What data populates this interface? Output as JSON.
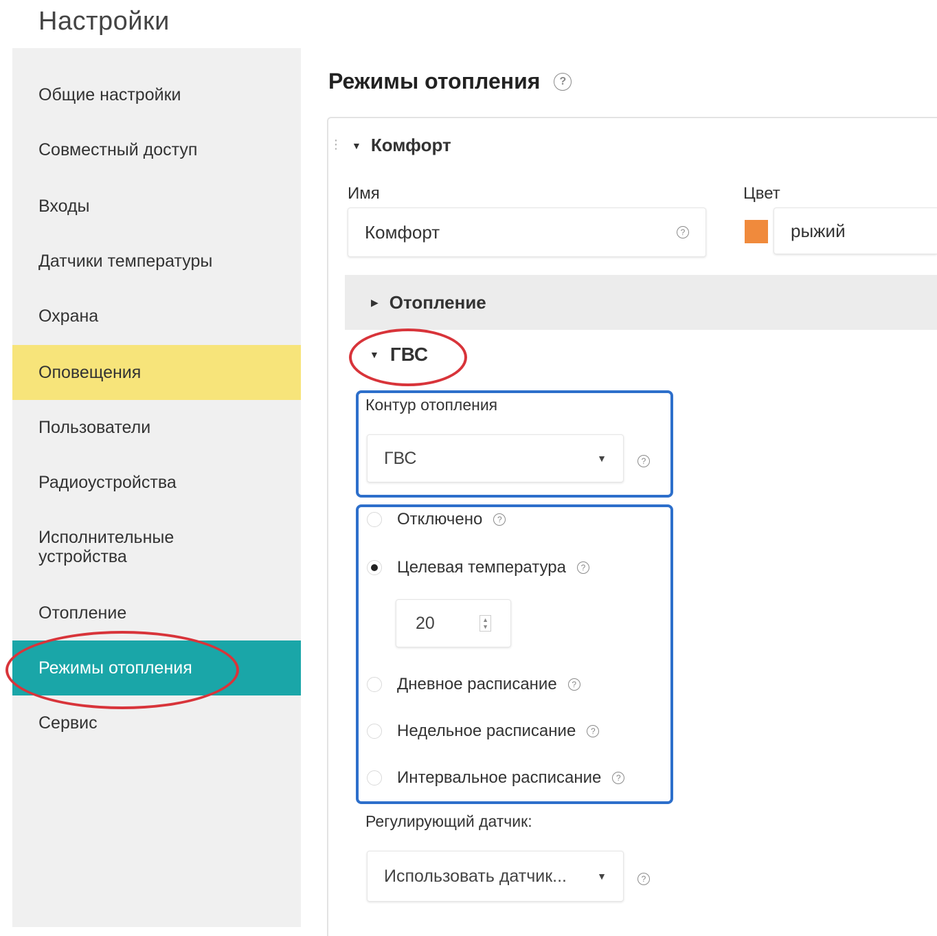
{
  "page_title": "Настройки",
  "sidebar": {
    "items": [
      {
        "label": "Общие настройки"
      },
      {
        "label": "Совместный доступ"
      },
      {
        "label": "Входы"
      },
      {
        "label": "Датчики температуры"
      },
      {
        "label": "Охрана"
      },
      {
        "label": "Оповещения"
      },
      {
        "label": "Пользователи"
      },
      {
        "label": "Радиоустройства"
      },
      {
        "label": "Исполнительные устройства"
      },
      {
        "label": "Отопление"
      },
      {
        "label": "Режимы отопления"
      },
      {
        "label": "Сервис"
      }
    ],
    "highlighted": "Оповещения",
    "active": "Режимы отопления"
  },
  "main": {
    "title": "Режимы отопления",
    "help_glyph": "?",
    "mode": {
      "name_header": "Комфорт",
      "name_label": "Имя",
      "name_value": "Комфорт",
      "color_label": "Цвет",
      "color_value": "рыжий",
      "color_hex": "#f08a3c",
      "heating_section": "Отопление",
      "hot_water_section": "ГВС",
      "circuit_label": "Контур отопления",
      "circuit_value": "ГВС",
      "radio_options": [
        {
          "label": "Отключено",
          "selected": false
        },
        {
          "label": "Целевая температура",
          "selected": true
        },
        {
          "label": "Дневное расписание",
          "selected": false
        },
        {
          "label": "Недельное расписание",
          "selected": false
        },
        {
          "label": "Интервальное расписание",
          "selected": false
        }
      ],
      "target_temperature": "20",
      "sensor_label": "Регулирующий датчик:",
      "sensor_value": "Использовать датчик..."
    }
  },
  "colors": {
    "active_item": "#1aa6a8",
    "highlight_item": "#f7e47a",
    "annotation_red": "#d8343a",
    "annotation_blue": "#2d6fcb"
  }
}
